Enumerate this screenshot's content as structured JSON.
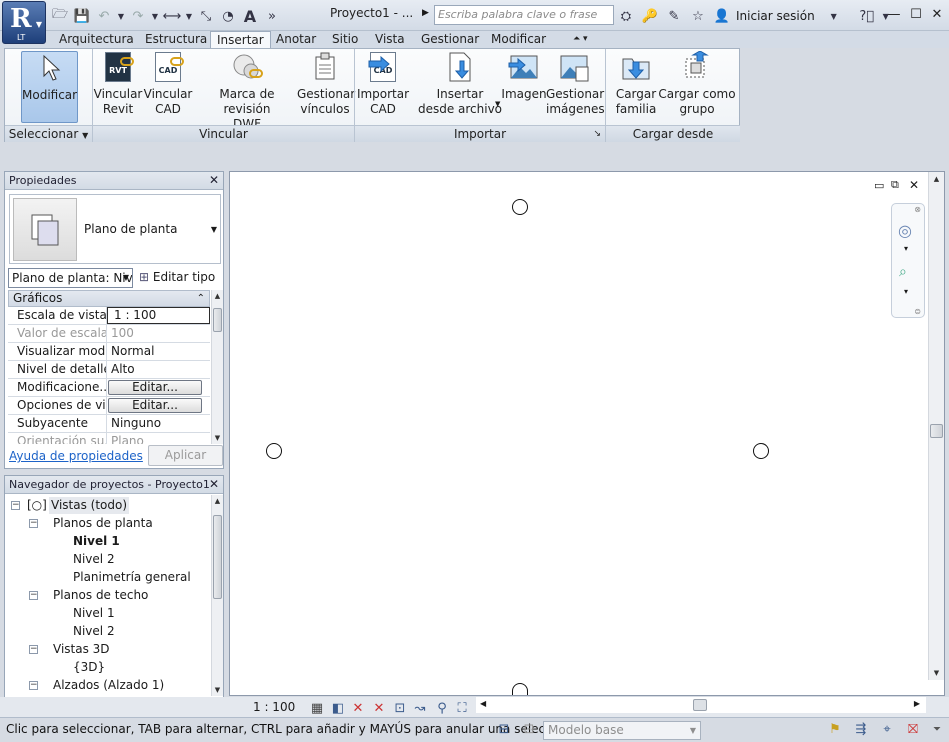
{
  "app": {
    "title": "Proyecto1 - ...",
    "logo_letter": "R",
    "logo_sub": "LT"
  },
  "search": {
    "placeholder": "Escriba palabra clave o frase"
  },
  "signin": "Iniciar sesión",
  "tabs": [
    "Arquitectura",
    "Estructura",
    "Insertar",
    "Anotar",
    "Sitio",
    "Vista",
    "Gestionar",
    "Modificar"
  ],
  "active_tab": "Insertar",
  "ribbon": {
    "modify": {
      "label": "Modificar"
    },
    "vincular_revit": {
      "l1": "Vincular",
      "l2": "Revit"
    },
    "vincular_cad": {
      "l1": "Vincular",
      "l2": "CAD"
    },
    "marca_dwf": {
      "l1": "Marca de revisión",
      "l2": "DWF"
    },
    "gestionar_vinculos": {
      "l1": "Gestionar",
      "l2": "vínculos"
    },
    "importar_cad": {
      "l1": "Importar",
      "l2": "CAD"
    },
    "insertar_archivo": {
      "l1": "Insertar",
      "l2": "desde archivo"
    },
    "imagen": {
      "l1": "Imagen"
    },
    "gestionar_imagenes": {
      "l1": "Gestionar",
      "l2": "imágenes"
    },
    "cargar_familia": {
      "l1": "Cargar",
      "l2": "familia"
    },
    "cargar_grupo": {
      "l1": "Cargar como",
      "l2": "grupo"
    },
    "panels": {
      "select": "Seleccionar",
      "vincular": "Vincular",
      "importar": "Importar",
      "biblioteca": "Cargar desde biblioteca"
    },
    "icon_text": {
      "rvt": "RVT",
      "cad": "CAD"
    }
  },
  "properties": {
    "title": "Propiedades",
    "type_name": "Plano de planta",
    "instance_combo": "Plano de planta: Niv",
    "edit_type": "Editar tipo",
    "group": "Gráficos",
    "rows": [
      {
        "k": "Escala de vista",
        "v": "1 : 100"
      },
      {
        "k": "Valor de escala...",
        "v": "100"
      },
      {
        "k": "Visualizar mod...",
        "v": "Normal"
      },
      {
        "k": "Nivel de detalle",
        "v": "Alto"
      },
      {
        "k": "Modificacione...",
        "v": "Editar..."
      },
      {
        "k": "Opciones de vi...",
        "v": "Editar..."
      },
      {
        "k": "Subyacente",
        "v": "Ninguno"
      },
      {
        "k": "Orientación su...",
        "v": "Plano"
      }
    ],
    "help": "Ayuda de propiedades",
    "apply": "Aplicar"
  },
  "navigator": {
    "title": "Navegador de proyectos - Proyecto1",
    "nodes": [
      {
        "text": "Vistas (todo)"
      },
      {
        "text": "Planos de planta"
      },
      {
        "text": "Nivel 1"
      },
      {
        "text": "Nivel 2"
      },
      {
        "text": "Planimetría general"
      },
      {
        "text": "Planos de techo"
      },
      {
        "text": "Nivel 1"
      },
      {
        "text": "Nivel 2"
      },
      {
        "text": "Vistas 3D"
      },
      {
        "text": "{3D}"
      },
      {
        "text": "Alzados (Alzado 1)"
      }
    ]
  },
  "view_bar": {
    "scale": "1 : 100"
  },
  "status": {
    "text": "Clic para seleccionar, TAB para alternar, CTRL para añadir y MAYÚS para anular una selecció",
    "model": "Modelo base"
  },
  "icons": {
    "open": "folder-open-icon",
    "save": "save-icon",
    "undo": "undo-icon",
    "redo": "redo-icon",
    "measure": "measure-icon",
    "text": "text-icon",
    "binoculars": "binoculars-icon",
    "star": "star-icon",
    "help": "help-icon",
    "close": "close-icon"
  },
  "colors": {
    "accent": "#1d63c8",
    "selected": "#a9c7ea",
    "brand": "#1e3f7a"
  }
}
